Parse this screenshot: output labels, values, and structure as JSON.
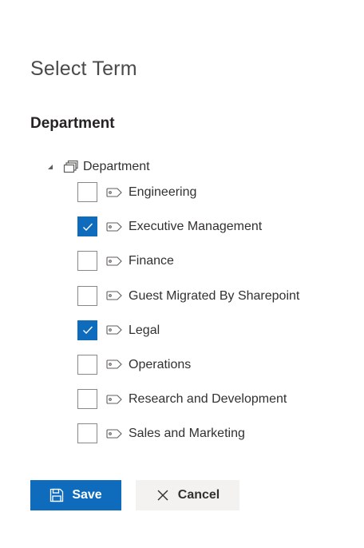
{
  "panel": {
    "title": "Select Term",
    "section_title": "Department"
  },
  "tree": {
    "root": {
      "label": "Department",
      "expanded": true,
      "expander_icon": "triangle-expanded-icon",
      "icon": "termset-icon"
    },
    "terms": [
      {
        "label": "Engineering",
        "checked": false
      },
      {
        "label": "Executive Management",
        "checked": true
      },
      {
        "label": "Finance",
        "checked": false
      },
      {
        "label": "Guest Migrated By Sharepoint",
        "checked": false
      },
      {
        "label": "Legal",
        "checked": true
      },
      {
        "label": "Operations",
        "checked": false
      },
      {
        "label": "Research and Development",
        "checked": false
      },
      {
        "label": "Sales and Marketing",
        "checked": false
      }
    ],
    "term_icon": "tag-icon"
  },
  "actions": {
    "save_label": "Save",
    "cancel_label": "Cancel",
    "save_icon": "save-icon",
    "cancel_icon": "close-icon"
  },
  "colors": {
    "accent": "#0f6cbd",
    "secondary_button": "#f3f2f1",
    "text": "#323130",
    "checkbox_border": "#8a8886"
  }
}
